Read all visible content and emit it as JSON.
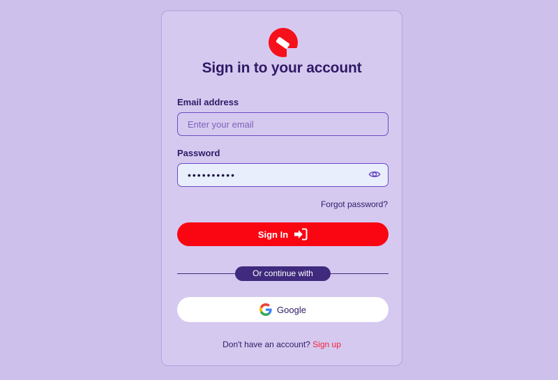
{
  "title": "Sign in to your account",
  "email": {
    "label": "Email address",
    "placeholder": "Enter your email",
    "value": ""
  },
  "password": {
    "label": "Password",
    "value": "••••••••••"
  },
  "forgot_password": "Forgot password?",
  "sign_in_label": "Sign In",
  "divider_text": "Or continue with",
  "google_label": "Google",
  "footer": {
    "prompt": "Don't have an account?",
    "link": "Sign up"
  },
  "icons": {
    "logo": "brand-logo-icon",
    "eye": "eye-icon",
    "sign_in": "sign-in-icon",
    "google": "google-icon"
  },
  "colors": {
    "background": "#cdc0ea",
    "card": "#d6c9f0",
    "primary": "#fa0512",
    "heading": "#2e1a66",
    "accent_purple": "#3f2a7d",
    "link": "#f0243a"
  }
}
